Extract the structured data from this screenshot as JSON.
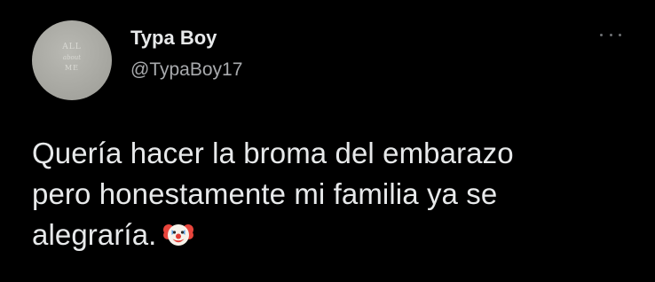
{
  "tweet": {
    "author": {
      "display_name": "Typa Boy",
      "handle": "@TypaBoy17",
      "avatar_text": [
        "ALL",
        "about",
        "ME"
      ]
    },
    "text_lines": [
      "Quería hacer la broma del embarazo",
      "pero honestamente mi familia ya se",
      "alegraría."
    ],
    "emoji": "clown-face-icon",
    "more_icon": "more-options-icon"
  },
  "colors": {
    "background": "#000000",
    "primary_text": "#e7e9ea",
    "secondary_text": "#a8aaad",
    "avatar_bg": "#a9a9a3"
  }
}
